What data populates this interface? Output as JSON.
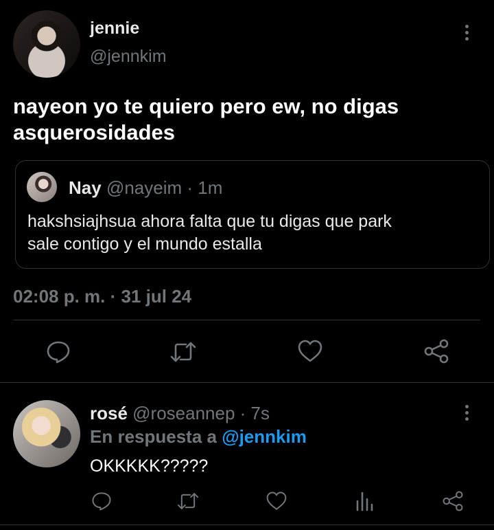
{
  "tweet": {
    "author_name": "jennie",
    "author_handle": "@jennkim",
    "text_line1": "nayeon yo te quiero pero ew, no digas",
    "text_line2": "asquerosidades",
    "timestamp": "02:08 p. m. · 31 jul 24",
    "quote": {
      "author_name": "Nay",
      "author_handle": "@nayeim",
      "time": "· 1m",
      "text_line1": "hakshsiajhsua ahora falta que tu digas que park",
      "text_line2": "sale contigo y el mundo estalla"
    },
    "actions": [
      "reply-icon",
      "retweet-icon",
      "like-icon",
      "share-icon"
    ]
  },
  "reply": {
    "author_name": "rosé",
    "author_handle": "@roseannep",
    "time": "· 7s",
    "in_reply_prefix": "En respuesta a",
    "in_reply_handle": "@jennkim",
    "text": "OKKKKK?????",
    "actions": [
      "reply-icon",
      "retweet-icon",
      "like-icon",
      "views-icon",
      "share-icon"
    ]
  },
  "colors": {
    "background": "#000000",
    "text": "#e7e9ea",
    "muted": "#71767b",
    "link": "#1d9bf0",
    "border": "#2f3336"
  }
}
